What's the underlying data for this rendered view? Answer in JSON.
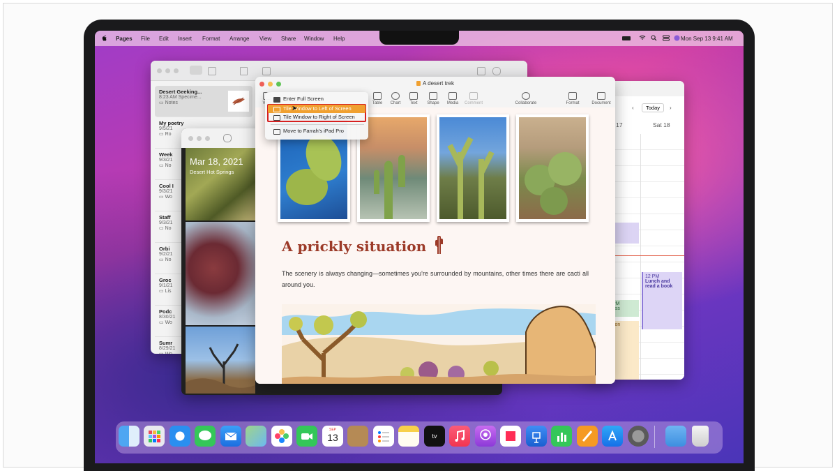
{
  "menubar": {
    "app_name": "Pages",
    "items": [
      "File",
      "Edit",
      "Insert",
      "Format",
      "Arrange",
      "View",
      "Share",
      "Window",
      "Help"
    ],
    "datetime": "Mon Sep 13  9:41 AM"
  },
  "notes": {
    "items": [
      {
        "title": "Desert Geeking...",
        "meta": "8:23 AM  Specime...",
        "folder": "Notes"
      },
      {
        "title": "My poetry",
        "meta": "9/5/21",
        "folder": "Ro"
      },
      {
        "title": "Week",
        "meta": "9/3/21",
        "folder": "No"
      },
      {
        "title": "Cool I",
        "meta": "9/3/21",
        "folder": "Wo"
      },
      {
        "title": "Staff",
        "meta": "9/3/21",
        "folder": "No"
      },
      {
        "title": "Orbi",
        "meta": "9/2/21",
        "folder": "No"
      },
      {
        "title": "Groc",
        "meta": "9/1/21",
        "folder": "Lis"
      },
      {
        "title": "Podc",
        "meta": "8/30/21",
        "folder": "Wo"
      },
      {
        "title": "Sumr",
        "meta": "8/29/21",
        "folder": "Wo"
      }
    ]
  },
  "photos": {
    "date": "Mar 18, 2021",
    "location": "Desert Hot Springs"
  },
  "calendar": {
    "today_label": "Today",
    "day_left": "h 17",
    "day_right": "Sat 18",
    "event_time": "12 PM",
    "event_title": "Lunch and read a book",
    "left_event_a": "PM",
    "left_event_b": "ass",
    "left_event_c": "son"
  },
  "pages": {
    "window_title": "A desert trek",
    "toolbar": [
      "View",
      "Table",
      "Chart",
      "Text",
      "Shape",
      "Media",
      "Comment",
      "Collaborate",
      "Format",
      "Document"
    ],
    "heading": "A prickly situation",
    "body": "The scenery is always changing—sometimes you're surrounded by mountains, other times there are cacti all around you."
  },
  "window_menu": {
    "items": [
      "Enter Full Screen",
      "Tile Window to Left of Screen",
      "Tile Window to Right of Screen",
      "Move to Farrah's iPad Pro"
    ],
    "highlighted_index": 1,
    "boxed_range": [
      1,
      2
    ]
  },
  "dock": {
    "apps": [
      "finder-icon",
      "launchpad-icon",
      "safari-icon",
      "messages-icon",
      "mail-icon",
      "maps-icon",
      "photos-icon",
      "facetime-icon",
      "calendar-icon",
      "contacts-icon",
      "reminders-icon",
      "notes-icon",
      "appletv-icon",
      "music-icon",
      "podcasts-icon",
      "news-icon",
      "keynote-icon",
      "numbers-icon",
      "pages-icon",
      "appstore-icon",
      "settings-icon",
      "downloads-icon",
      "trash-icon"
    ],
    "calendar_month": "SEP",
    "calendar_day": "13",
    "appletv_label": "tv"
  },
  "colors": {
    "menu_highlight": "#f0a030",
    "annotation_box": "#d62020",
    "heading_color": "#9c3a28",
    "accent_blue": "#1e7cf3"
  }
}
